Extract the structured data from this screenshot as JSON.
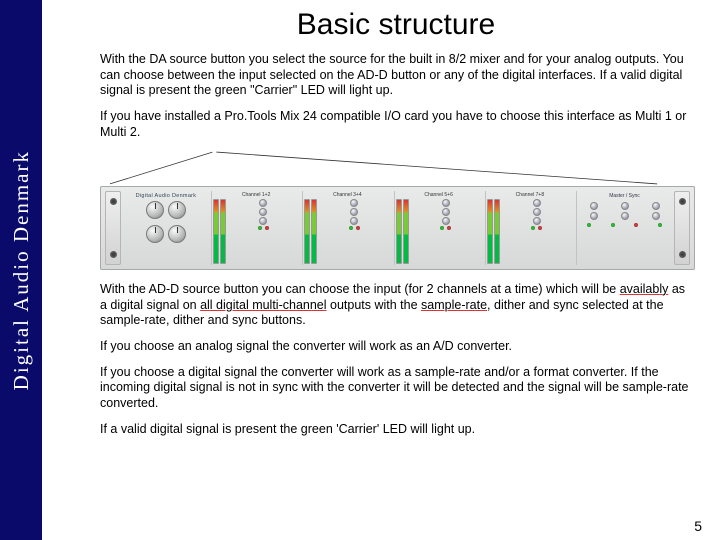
{
  "sidebar": {
    "brand": "Digital Audio Denmark"
  },
  "title": "Basic structure",
  "paragraphs": {
    "p1": "With the DA source button you select the source for the built in 8/2 mixer and for your analog outputs. You can choose between the input selected on the AD-D button or any of the digital interfaces. If a valid digital signal is present the green \"Carrier\" LED will light up.",
    "p2": "If you have installed a Pro.Tools Mix 24 compatible I/O card you have to choose this interface as Multi 1 or Multi 2.",
    "p3_pre": "With the AD-D source button you can choose the input (for 2 channels at a time) which will be ",
    "p3_u1": "availably",
    "p3_mid1": " as a digital signal on ",
    "p3_u2": "all digital multi-channel",
    "p3_mid2": " outputs with the ",
    "p3_u3": "sample-rate",
    "p3_mid3": ", dither and sync selected at the sample-rate, dither and sync buttons.",
    "p4": "If you choose an analog signal the converter will work as an A/D converter.",
    "p5": "If you choose a digital signal the converter will work as a sample-rate and/or a format converter. If the incoming digital signal is not in sync with the converter it will be detected and the signal will be sample-rate converted.",
    "p6": "If a valid digital signal is present the green 'Carrier' LED will light up."
  },
  "rack": {
    "brand_label": "Digital Audio Denmark",
    "channels": [
      {
        "label": "Channel 1+2"
      },
      {
        "label": "Channel 3+4"
      },
      {
        "label": "Channel 5+6"
      },
      {
        "label": "Channel 7+8"
      }
    ],
    "right_label": "Master / Sync"
  },
  "page_number": "5"
}
